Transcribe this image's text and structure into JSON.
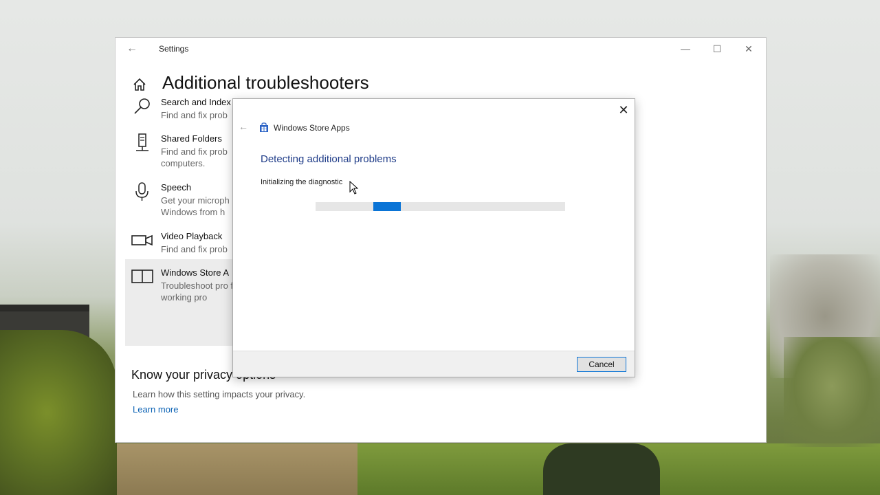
{
  "window": {
    "title": "Settings",
    "controls": {
      "minimize": "—",
      "maximize": "☐",
      "close": "✕"
    },
    "back_glyph": "←"
  },
  "page": {
    "title": "Additional troubleshooters"
  },
  "troubleshooters": [
    {
      "name": "Search and Indexing",
      "name_visible": "Search and Index",
      "desc": "Find and fix prob",
      "icon": "search-icon"
    },
    {
      "name": "Shared Folders",
      "name_visible": "Shared Folders",
      "desc": "Find and fix prob computers.",
      "icon": "server-icon"
    },
    {
      "name": "Speech",
      "name_visible": "Speech",
      "desc": "Get your microph Windows from h",
      "icon": "microphone-icon"
    },
    {
      "name": "Video Playback",
      "name_visible": "Video Playback",
      "desc": "Find and fix prob",
      "icon": "video-camera-icon"
    },
    {
      "name": "Windows Store Apps",
      "name_visible": "Windows Store A",
      "desc": "Troubleshoot pro from working pro",
      "icon": "store-apps-icon"
    }
  ],
  "privacy": {
    "title": "Know your privacy options",
    "desc": "Learn how this setting impacts your privacy.",
    "link": "Learn more"
  },
  "dialog": {
    "app_name": "Windows Store Apps",
    "heading": "Detecting additional problems",
    "status": "Initializing the diagnostic",
    "close_glyph": "✕",
    "back_glyph": "←",
    "cancel_label": "Cancel",
    "accent_color": "#0a74d6",
    "heading_color": "#1f3c88"
  }
}
